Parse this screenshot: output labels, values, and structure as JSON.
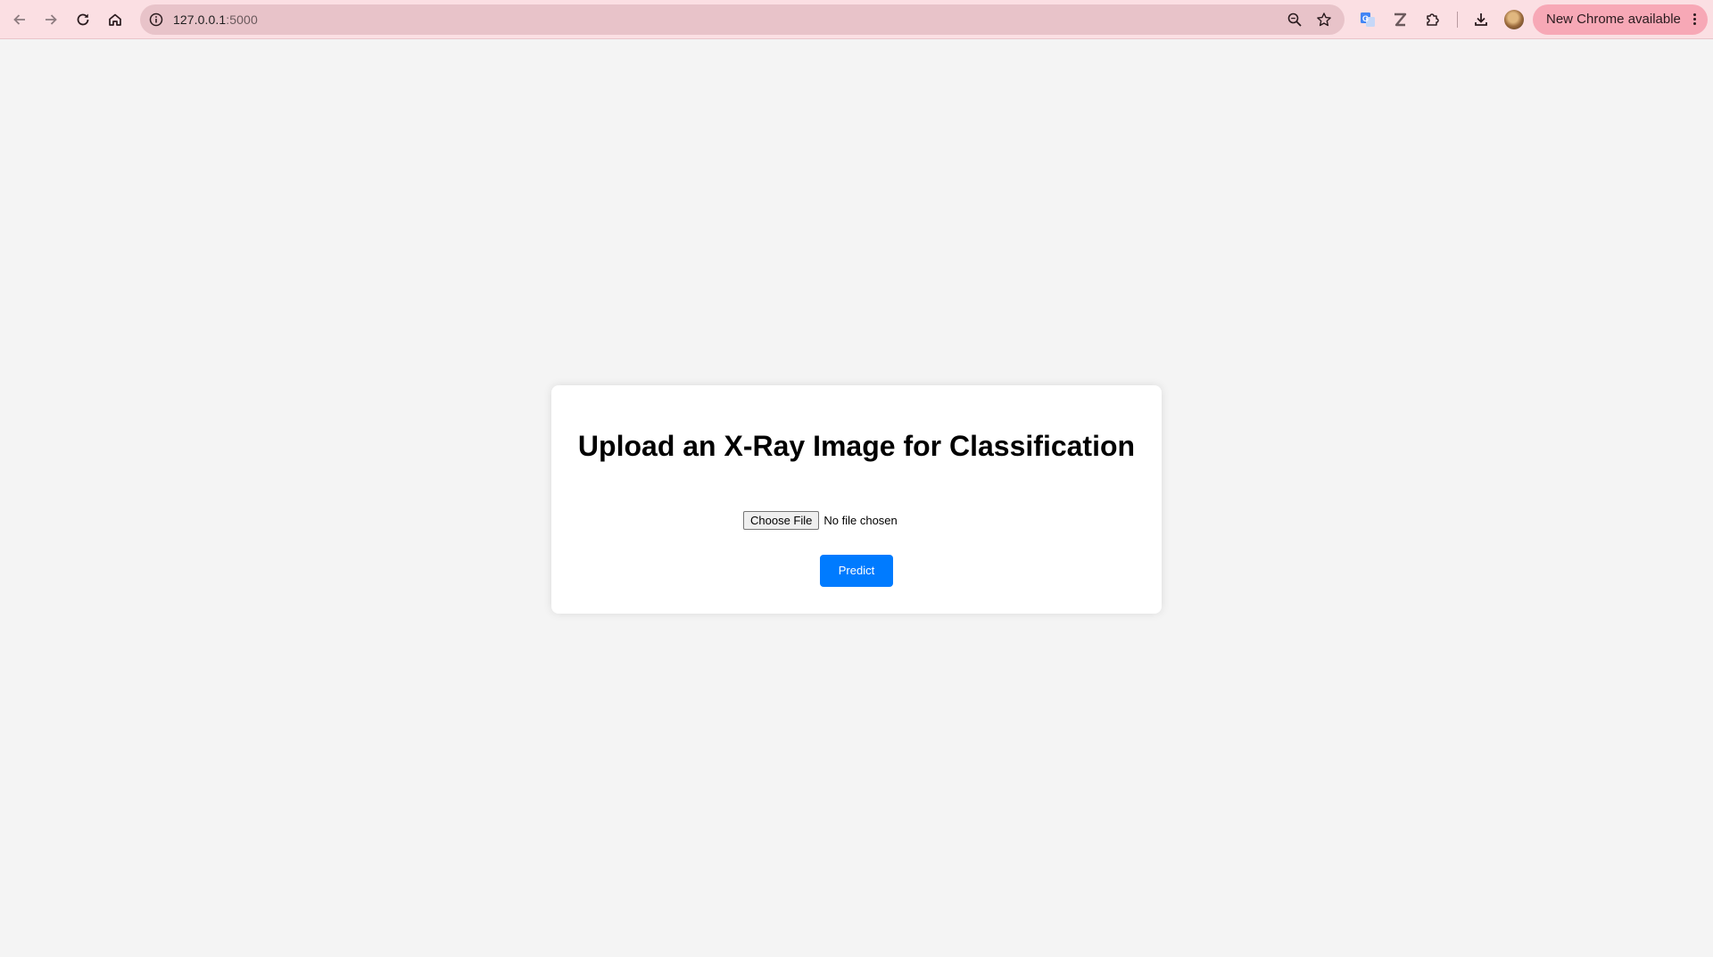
{
  "browser": {
    "url_host": "127.0.0.1",
    "url_port": ":5000",
    "update_label": "New Chrome available"
  },
  "page": {
    "heading": "Upload an X-Ray Image for Classification",
    "choose_file_label": "Choose File",
    "no_file_text": "No file chosen",
    "predict_label": "Predict"
  },
  "colors": {
    "toolbar_bg": "#fbdfe3",
    "omnibox_bg": "#e8c3c9",
    "update_button_bg": "#f7a8b6",
    "page_bg": "#f4f4f4",
    "predict_button_bg": "#007bff"
  },
  "icons": {
    "back": "back-arrow-icon",
    "forward": "forward-arrow-icon",
    "reload": "reload-icon",
    "home": "home-icon",
    "site_info": "info-icon",
    "zoom": "zoom-icon",
    "bookmark": "star-icon",
    "translate": "translate-icon",
    "zotero": "zotero-icon",
    "extensions": "puzzle-icon",
    "downloads": "download-icon",
    "menu": "kebab-menu-icon"
  }
}
